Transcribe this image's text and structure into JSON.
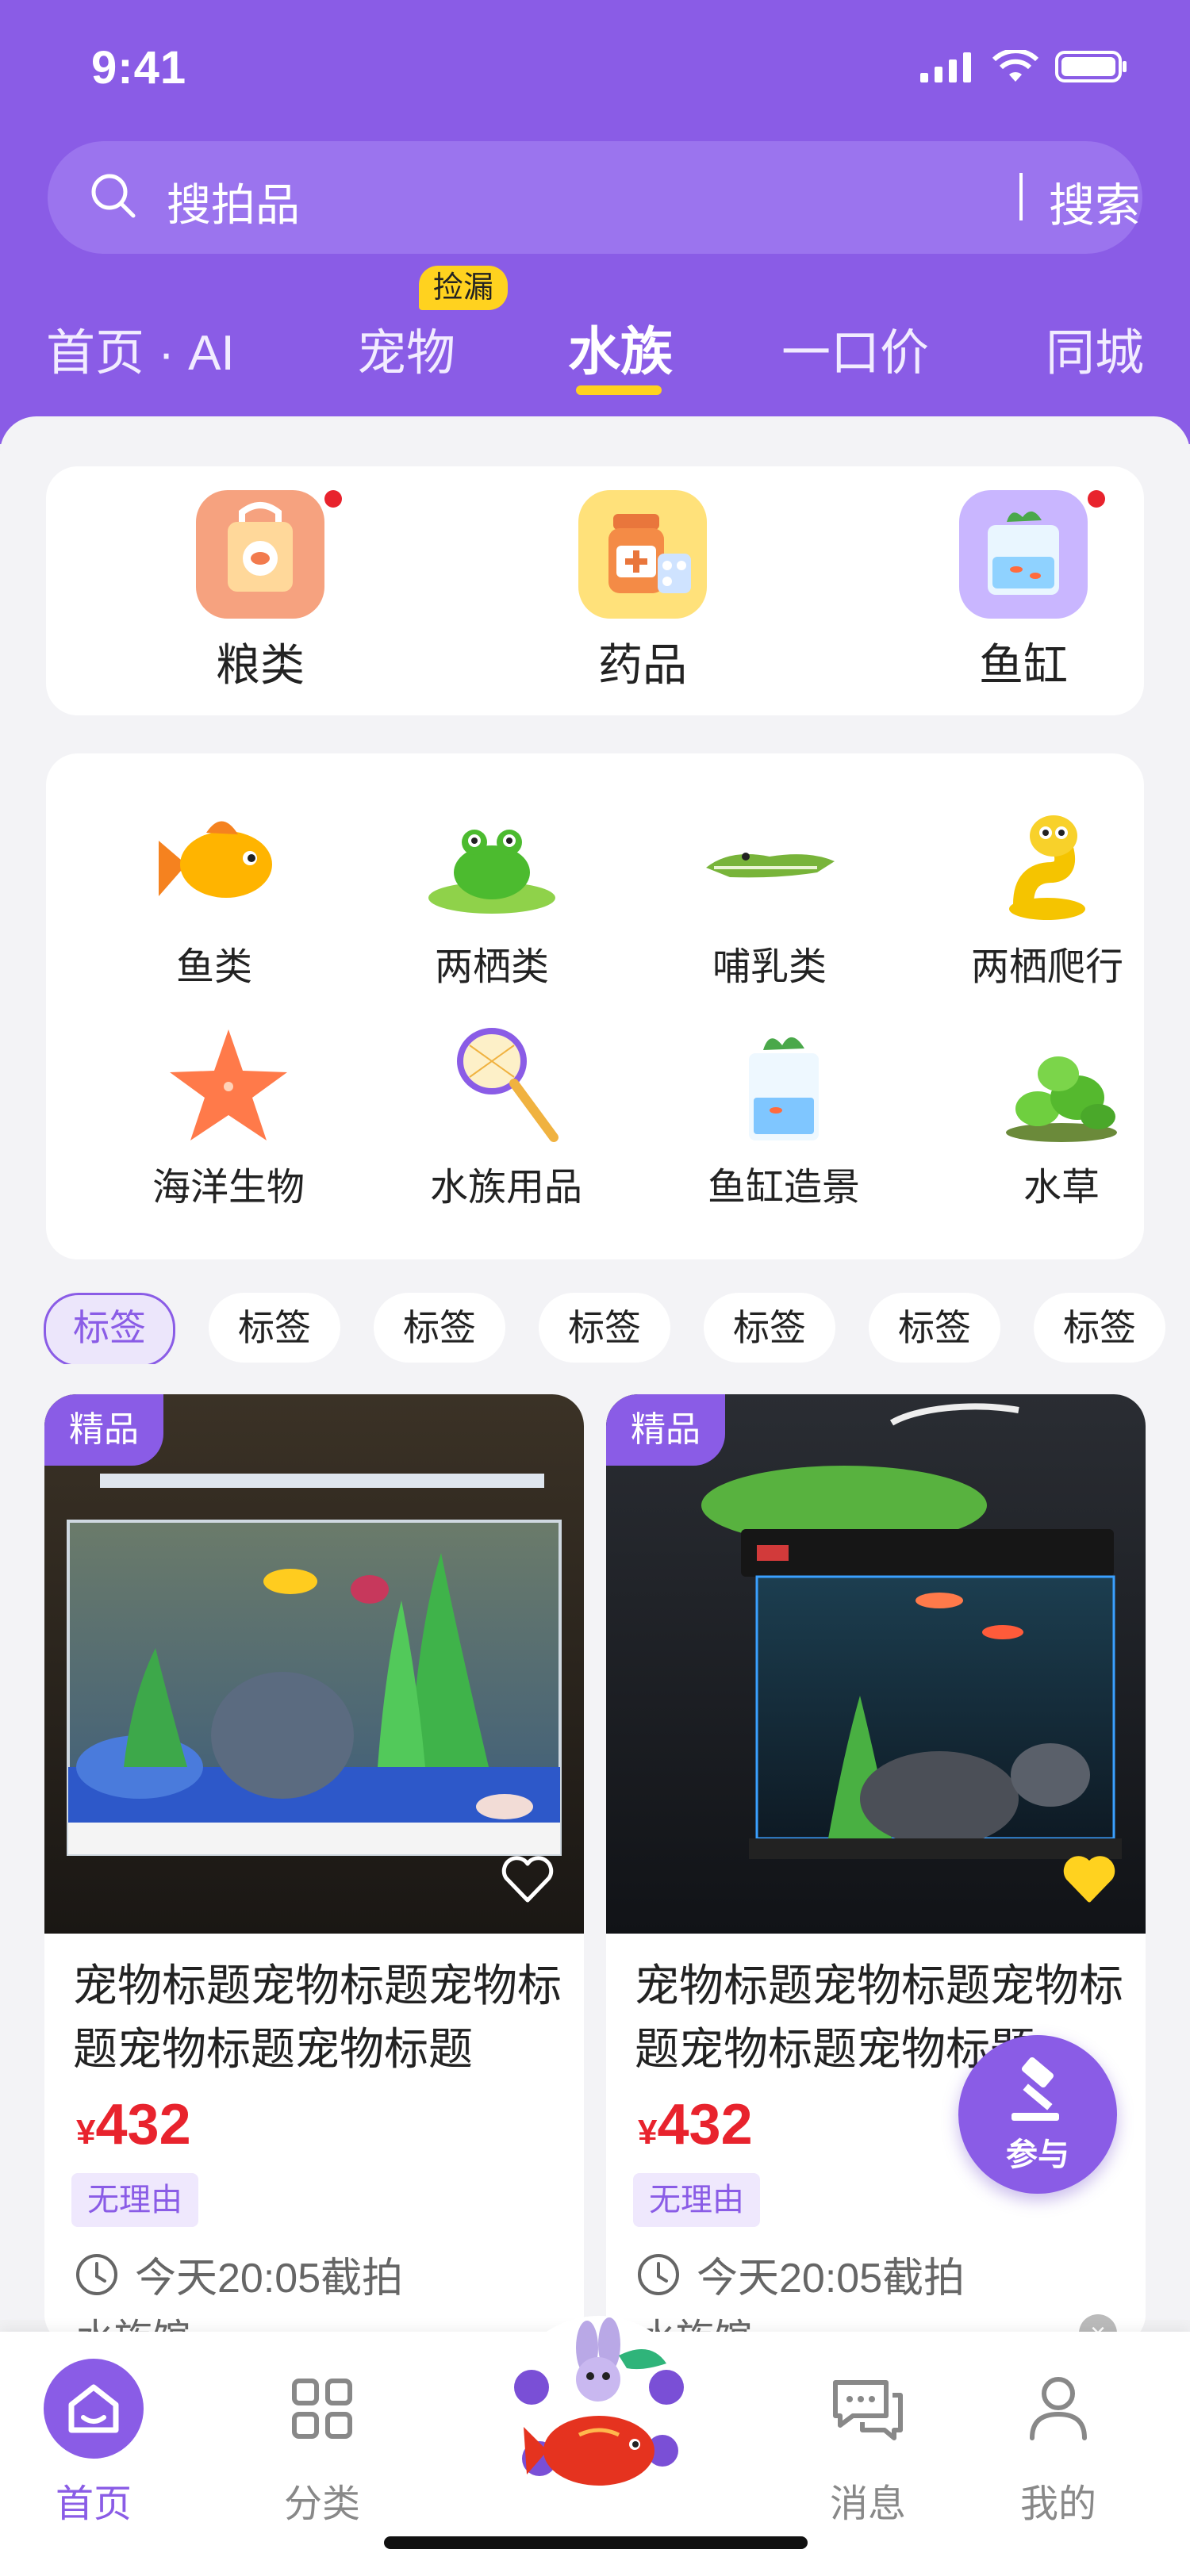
{
  "status_bar": {
    "time": "9:41"
  },
  "search": {
    "placeholder": "搜拍品",
    "button": "搜索"
  },
  "tabs": [
    {
      "label": "首页 · AI"
    },
    {
      "label": "宠物",
      "badge": "捡漏"
    },
    {
      "label": "水族",
      "active": true
    },
    {
      "label": "一口价"
    },
    {
      "label": "同城"
    }
  ],
  "quick_entries": [
    {
      "label": "粮类",
      "icon": "food-bag-icon"
    },
    {
      "label": "药品",
      "icon": "medicine-icon"
    },
    {
      "label": "鱼缸",
      "icon": "fish-tank-icon"
    }
  ],
  "categories": [
    {
      "label": "鱼类",
      "icon": "goldfish-icon"
    },
    {
      "label": "两栖类",
      "icon": "frog-icon"
    },
    {
      "label": "哺乳类",
      "icon": "crocodile-icon"
    },
    {
      "label": "两栖爬行",
      "icon": "snake-icon"
    },
    {
      "label": "海洋生物",
      "icon": "starfish-icon"
    },
    {
      "label": "水族用品",
      "icon": "fishing-net-icon"
    },
    {
      "label": "鱼缸造景",
      "icon": "aquarium-icon"
    },
    {
      "label": "水草",
      "icon": "water-plant-icon"
    }
  ],
  "filter_chips": [
    "标签",
    "标签",
    "标签",
    "标签",
    "标签",
    "标签",
    "标签"
  ],
  "products": [
    {
      "tag": "精品",
      "title": "宠物标题宠物标题宠物标题宠物标题宠物标题",
      "currency": "¥",
      "price": "432",
      "label": "无理由",
      "deadline": "今天20:05截拍",
      "shop": "水族馆",
      "favorited": false
    },
    {
      "tag": "精品",
      "title": "宠物标题宠物标题宠物标题宠物标题宠物标题",
      "currency": "¥",
      "price": "432",
      "label": "无理由",
      "deadline": "今天20:05截拍",
      "shop": "水族馆",
      "favorited": true
    }
  ],
  "fab": {
    "label": "参与"
  },
  "bottom_nav": [
    {
      "label": "首页",
      "active": true
    },
    {
      "label": "分类"
    },
    {
      "label": "消息"
    },
    {
      "label": "我的"
    }
  ],
  "colors": {
    "brand": "#8a5ce6",
    "accent": "#ffd21f",
    "price": "#e8232d"
  }
}
